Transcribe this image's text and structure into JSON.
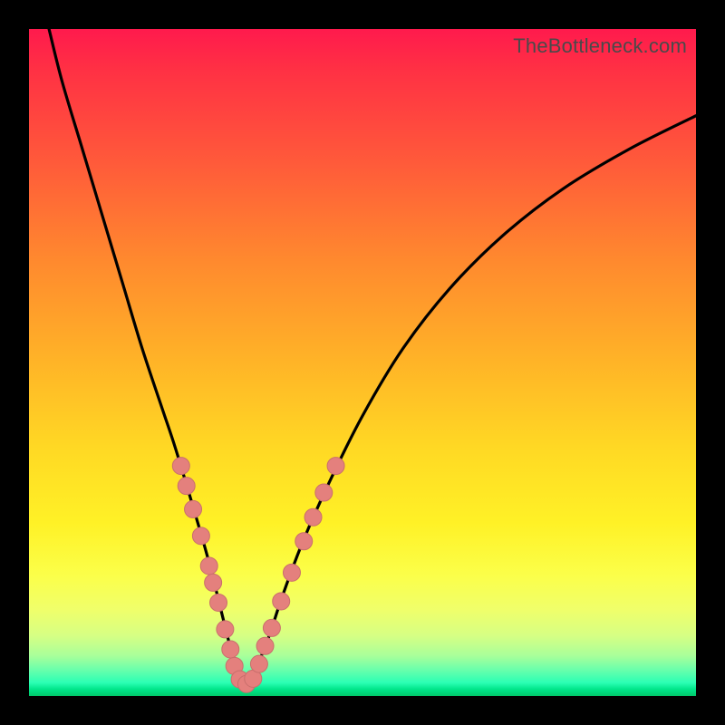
{
  "watermark": "TheBottleneck.com",
  "colors": {
    "curve": "#000000",
    "marker_fill": "#e4807d",
    "marker_stroke": "#c96f6c"
  },
  "chart_data": {
    "type": "line",
    "title": "",
    "xlabel": "",
    "ylabel": "",
    "xlim": [
      0,
      100
    ],
    "ylim": [
      0,
      100
    ],
    "grid": false,
    "legend": false,
    "series": [
      {
        "name": "bottleneck-curve",
        "x": [
          3,
          5,
          8,
          11,
          14,
          17,
          20,
          22,
          25,
          27,
          29,
          30,
          31,
          32,
          33,
          34,
          36,
          38,
          41,
          45,
          50,
          56,
          63,
          71,
          80,
          90,
          100
        ],
        "y": [
          100,
          92,
          82,
          72,
          62,
          52,
          43,
          37,
          27,
          20,
          12,
          8,
          4,
          2,
          2,
          4,
          9,
          15,
          23,
          32,
          42,
          52,
          61,
          69,
          76,
          82,
          87
        ]
      }
    ],
    "markers": {
      "name": "sample-dots",
      "points": [
        {
          "x": 22.8,
          "y": 34.5
        },
        {
          "x": 23.6,
          "y": 31.5
        },
        {
          "x": 24.6,
          "y": 28.0
        },
        {
          "x": 25.8,
          "y": 24.0
        },
        {
          "x": 27.0,
          "y": 19.5
        },
        {
          "x": 27.6,
          "y": 17.0
        },
        {
          "x": 28.4,
          "y": 14.0
        },
        {
          "x": 29.4,
          "y": 10.0
        },
        {
          "x": 30.2,
          "y": 7.0
        },
        {
          "x": 30.8,
          "y": 4.5
        },
        {
          "x": 31.6,
          "y": 2.5
        },
        {
          "x": 32.6,
          "y": 1.8
        },
        {
          "x": 33.6,
          "y": 2.6
        },
        {
          "x": 34.5,
          "y": 4.8
        },
        {
          "x": 35.4,
          "y": 7.5
        },
        {
          "x": 36.4,
          "y": 10.2
        },
        {
          "x": 37.8,
          "y": 14.2
        },
        {
          "x": 39.4,
          "y": 18.5
        },
        {
          "x": 41.2,
          "y": 23.2
        },
        {
          "x": 42.6,
          "y": 26.8
        },
        {
          "x": 44.2,
          "y": 30.5
        },
        {
          "x": 46.0,
          "y": 34.5
        }
      ]
    }
  }
}
